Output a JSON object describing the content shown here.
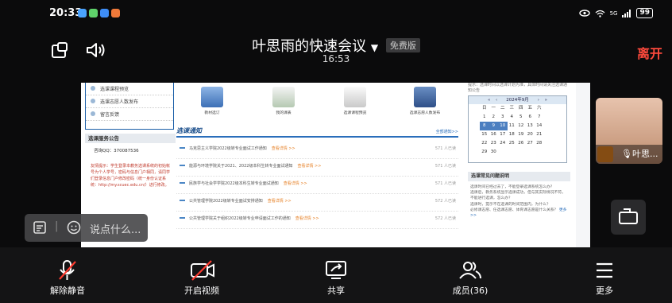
{
  "status_bar": {
    "time": "20:33",
    "signal": "5G",
    "battery": "99"
  },
  "meeting": {
    "title": "叶思雨的快速会议",
    "edition_badge": "免费版",
    "elapsed": "16:53",
    "leave_label": "离开"
  },
  "shared_page": {
    "left_menu": [
      "选课课程预览",
      "选课志愿人数发布",
      "留言反馈"
    ],
    "service_heading": "选课服务公告",
    "qq_label": "咨询QQ：",
    "qq_number": "370087536",
    "service_text": "友情提示：学生登录本教务选课系统的初始帐号为个人学号，密码与信息门户相同，请同学们登录信息门户修改密码（统一身份认证系统：http://my.scuec.edu.cn/）进行修改。",
    "tiles": [
      "教材选订",
      "我的课表",
      "选课课程预览",
      "选课志愿人数发布"
    ],
    "notice_title": "选课通知",
    "notice_more": "全部通知>>",
    "notices": [
      {
        "text": "马克思主义学院2022级转专业面试工作通知",
        "detail": "查看详情 >>",
        "views": "571 人已读"
      },
      {
        "text": "能源与环境学院关于2021、2022级本科生转专业面试通知",
        "detail": "查看详情 >>",
        "views": "571 人已读"
      },
      {
        "text": "民族学与社会学学院2022级本科生转专业面试通知",
        "detail": "查看详情 >>",
        "views": "571 人已读"
      },
      {
        "text": "公共管理学院2022级转专业面试安排通知",
        "detail": "查看详情 >>",
        "views": "572 人已读"
      },
      {
        "text": "公共管理学院关于组织2022级转专业申请面试工作的通知",
        "detail": "查看详情 >>",
        "views": "572 人已读"
      }
    ],
    "right_hint": "提示：选课时间以选课计划为准，具体时间请关注选课通知公告",
    "calendar": {
      "month_label": "2024年9月",
      "weekdays": [
        "日",
        "一",
        "二",
        "三",
        "四",
        "五",
        "六"
      ],
      "weeks": [
        [
          "1",
          "2",
          "3",
          "4",
          "5",
          "6",
          "7"
        ],
        [
          "8",
          "9",
          "10",
          "11",
          "12",
          "13",
          "14"
        ],
        [
          "15",
          "16",
          "17",
          "18",
          "19",
          "20",
          "21"
        ],
        [
          "22",
          "23",
          "24",
          "25",
          "26",
          "27",
          "28"
        ],
        [
          "29",
          "30",
          "",
          "",
          "",
          "",
          ""
        ]
      ],
      "selected": [
        "8",
        "9",
        "10"
      ]
    },
    "faq_heading": "选课常见问题说明",
    "faq": [
      "选课时间已经过去了，不能登录选课系统怎么办？",
      "选课后，教务系统显示选课成功，但与其实际情况不符，不能进行选课，怎么办？",
      "选课时，提示不在选课的时间范围内，为什么？",
      "必修课志愿、任选课志愿、体育课志愿是什么关系？"
    ],
    "faq_more": "更多>>"
  },
  "participant": {
    "name": "叶思..."
  },
  "chat": {
    "placeholder": "说点什么..."
  },
  "toolbar": {
    "unmute": "解除静音",
    "video": "开启视频",
    "share": "共享",
    "members": "成员(36)",
    "more": "更多"
  }
}
